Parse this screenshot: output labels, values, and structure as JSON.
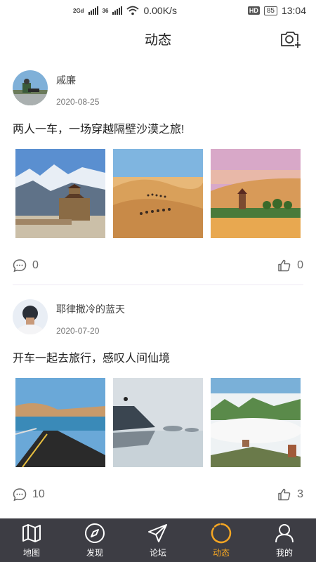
{
  "status_bar": {
    "network_left": "2Gd",
    "network_mid": "36",
    "speed": "0.00K/s",
    "hd": "HD",
    "battery": "85",
    "time": "13:04"
  },
  "header": {
    "title": "动态",
    "camera_icon": "camera-plus-icon"
  },
  "posts": [
    {
      "username": "戚廉",
      "date": "2020-08-25",
      "text": "两人一车，一场穿越隔壁沙漠之旅!",
      "comments": "0",
      "likes": "0"
    },
    {
      "username": "耶律撒冷的蓝天",
      "date": "2020-07-20",
      "text": "开车一起去旅行，感叹人间仙境",
      "comments": "10",
      "likes": "3"
    }
  ],
  "tabs": [
    {
      "label": "地图",
      "icon": "map-icon"
    },
    {
      "label": "发现",
      "icon": "compass-icon"
    },
    {
      "label": "论坛",
      "icon": "paper-plane-icon"
    },
    {
      "label": "动态",
      "icon": "loading-ring-icon",
      "active": true
    },
    {
      "label": "我的",
      "icon": "user-icon"
    }
  ],
  "colors": {
    "accent": "#f5a623",
    "tabbar_bg": "#3d3d44"
  }
}
